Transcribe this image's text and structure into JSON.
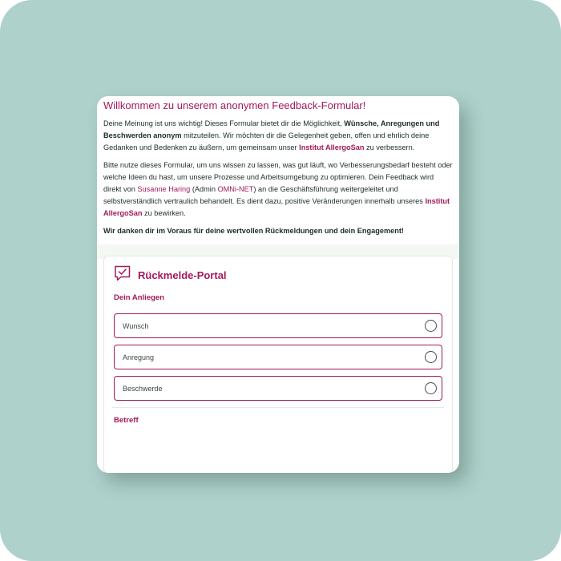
{
  "intro": {
    "title": "Willkommen zu unserem anonymen Feedback-Formular!",
    "p1": {
      "a": "Deine Meinung ist uns wichtig! Dieses Formular bietet dir die Möglichkeit, ",
      "b": "Wünsche, Anregungen und Beschwerden anonym",
      "c": " mitzuteilen. Wir möchten dir die Gelegenheit geben, offen und ehrlich deine Gedanken und Bedenken zu äußern, um gemeinsam unser ",
      "d": "Institut AllergoSan",
      "e": " zu verbessern."
    },
    "p2": {
      "a": "Bitte nutze dieses Formular, um uns wissen zu lassen, was gut läuft, wo Verbesserungsbedarf besteht oder welche Ideen du hast, um unsere Prozesse und Arbeitsumgebung zu optimieren. Dein Feedback wird direkt von ",
      "b": "Susanne Haring",
      "c": " (Admin ",
      "d": "OMNi-NET",
      "e": ") an die Geschäftsführung weitergeleitet und selbstverständlich vertraulich behandelt. Es dient dazu, positive Veränderungen innerhalb unseres ",
      "f": "Institut AllergoSan",
      "g": " zu bewirken."
    },
    "thanks": "Wir danken dir im Voraus für deine wertvollen Rückmeldungen und dein Engagement!"
  },
  "portal": {
    "title": "Rückmelde-Portal",
    "icon": "feedback-check-icon",
    "concern_label": "Dein Anliegen",
    "options": [
      {
        "label": "Wunsch"
      },
      {
        "label": "Anregung"
      },
      {
        "label": "Beschwerde"
      }
    ],
    "subject_label": "Betreff"
  },
  "colors": {
    "accent": "#a3195b",
    "background": "#aed1cb",
    "band": "#f3f8f2"
  }
}
